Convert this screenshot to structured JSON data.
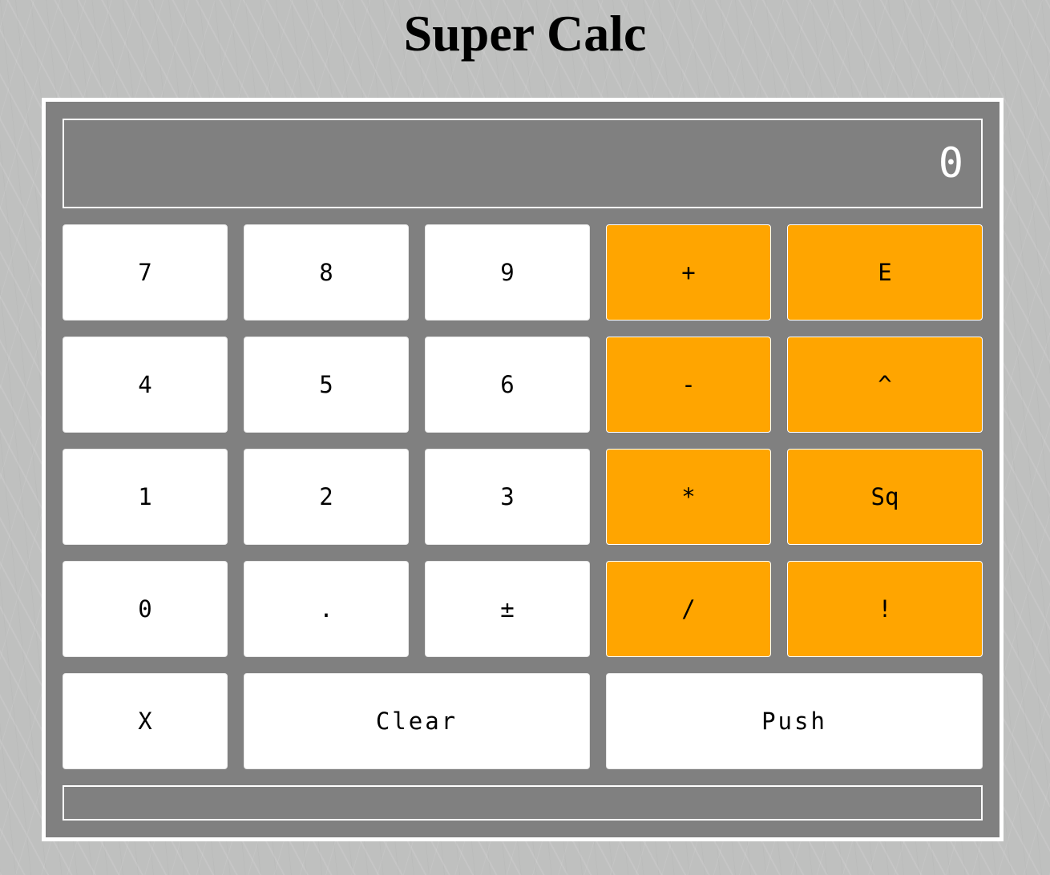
{
  "app": {
    "title": "Super Calc"
  },
  "display": {
    "value": "0"
  },
  "status": {
    "text": ""
  },
  "keys": {
    "seven": "7",
    "eight": "8",
    "nine": "9",
    "plus": "+",
    "exp": "E",
    "four": "4",
    "five": "5",
    "six": "6",
    "minus": "-",
    "power": "^",
    "one": "1",
    "two": "2",
    "three": "3",
    "multiply": "*",
    "square": "Sq",
    "zero": "0",
    "decimal": ".",
    "negate": "±",
    "divide": "/",
    "factorial": "!",
    "drop": "X",
    "clear": "Clear",
    "push": "Push"
  },
  "colors": {
    "operator_key": "#ffa500",
    "number_key": "#ffffff",
    "panel": "#808080",
    "background": "#bfc0bf"
  }
}
